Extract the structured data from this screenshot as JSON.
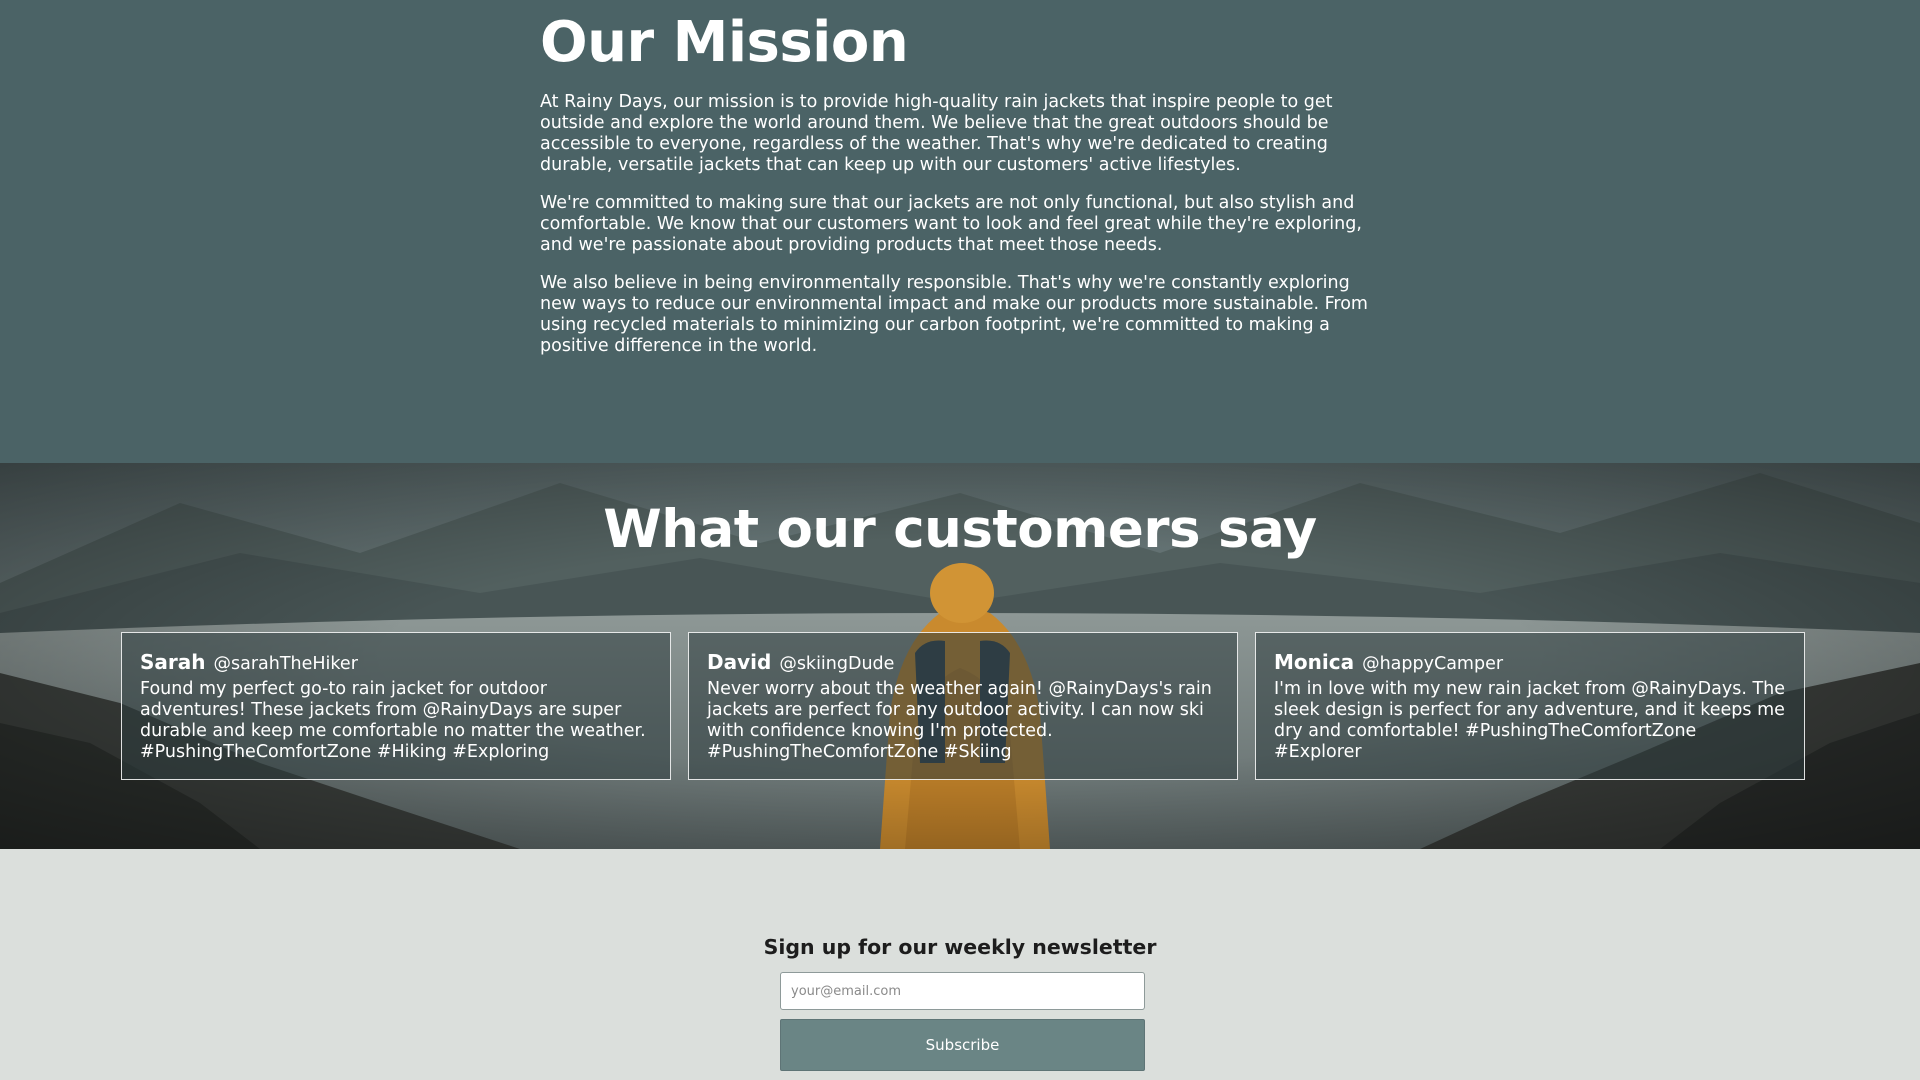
{
  "mission": {
    "title": "Our Mission",
    "paragraphs": [
      "At Rainy Days, our mission is to provide high-quality rain jackets that inspire people to get outside and explore the world around them. We believe that the great outdoors should be accessible to everyone, regardless of the weather. That's why we're dedicated to creating durable, versatile jackets that can keep up with our customers' active lifestyles.",
      "We're committed to making sure that our jackets are not only functional, but also stylish and comfortable. We know that our customers want to look and feel great while they're exploring, and we're passionate about providing products that meet those needs.",
      "We also believe in being environmentally responsible. That's why we're constantly exploring new ways to reduce our environmental impact and make our products more sustainable. From using recycled materials to minimizing our carbon footprint, we're committed to making a positive difference in the world."
    ]
  },
  "testimonials": {
    "title": "What our customers say",
    "cards": [
      {
        "name": "Sarah",
        "handle": "@sarahTheHiker",
        "text": "Found my perfect go-to rain jacket for outdoor adventures! These jackets from @RainyDays are super durable and keep me comfortable no matter the weather. #PushingTheComfortZone #Hiking #Exploring"
      },
      {
        "name": "David",
        "handle": "@skiingDude",
        "text": "Never worry about the weather again! @RainyDays's rain jackets are perfect for any outdoor activity. I can now ski with confidence knowing I'm protected. #PushingTheComfortZone #Skiing"
      },
      {
        "name": "Monica",
        "handle": "@happyCamper",
        "text": "I'm in love with my new rain jacket from @RainyDays. The sleek design is perfect for any adventure, and it keeps me dry and comfortable! #PushingTheComfortZone #Explorer"
      }
    ]
  },
  "newsletter": {
    "title": "Sign up for our weekly newsletter",
    "email_placeholder": "your@email.com",
    "email_value": "",
    "subscribe_label": "Subscribe"
  },
  "colors": {
    "mission_bg": "#4b6366",
    "newsletter_bg": "#dbdfdc",
    "button_bg": "#6a8585",
    "jacket": "#c98a2e"
  }
}
